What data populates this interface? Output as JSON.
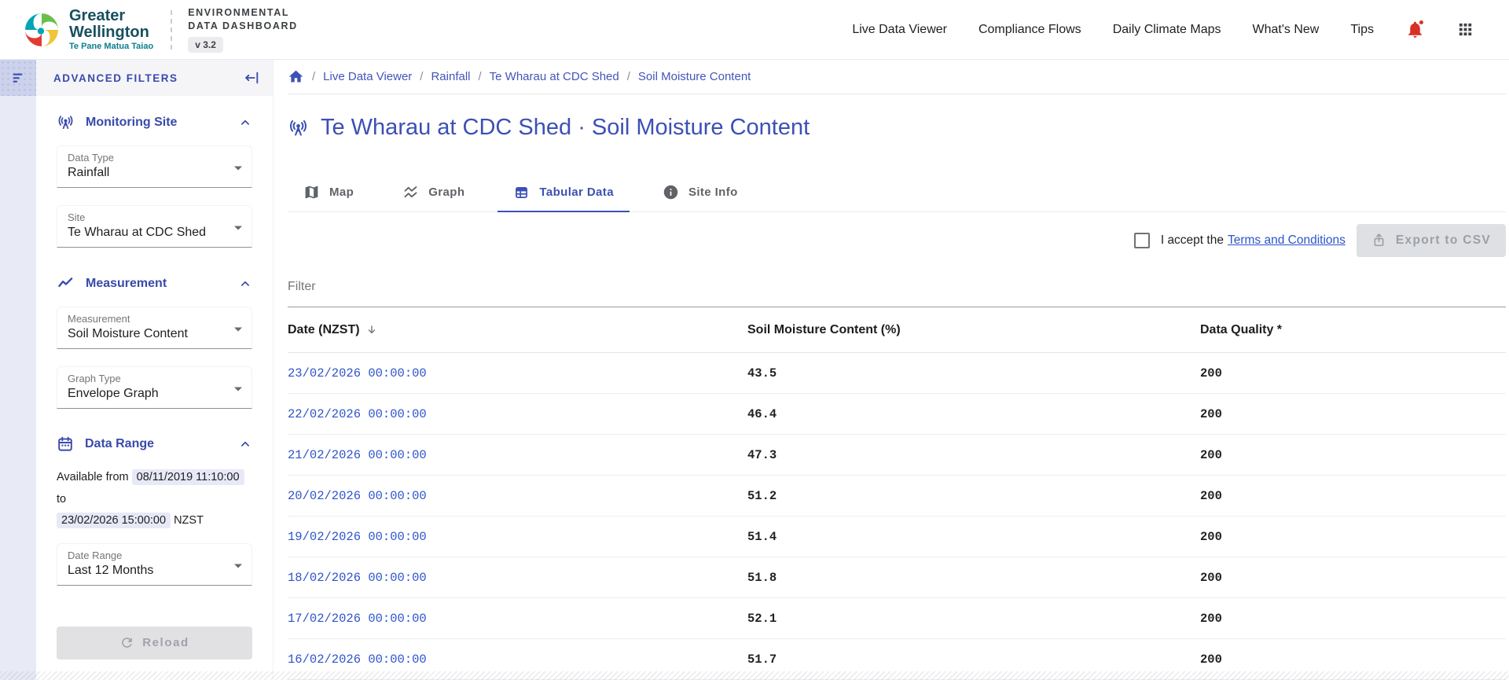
{
  "colors": {
    "primary": "#3f51b5",
    "title_blue": "#3c50b5",
    "table_link_blue": "#2d53cb",
    "bell_red": "#d93025",
    "logo_green": "#6abf4b",
    "logo_teal": "#00a5b5",
    "logo_red": "#e03c31",
    "logo_yellow": "#f2c437"
  },
  "header": {
    "logo": {
      "name_line1": "Greater",
      "name_line2": "Wellington",
      "tagline": "Te Pane Matua Taiao"
    },
    "app_title_line1": "ENVIRONMENTAL",
    "app_title_line2": "DATA DASHBOARD",
    "version": "v 3.2",
    "nav": [
      "Live Data Viewer",
      "Compliance Flows",
      "Daily Climate Maps",
      "What's New",
      "Tips"
    ]
  },
  "sidebar": {
    "header": "ADVANCED FILTERS",
    "monitoring_site": {
      "title": "Monitoring Site",
      "data_type": {
        "label": "Data Type",
        "value": "Rainfall"
      },
      "site": {
        "label": "Site",
        "value": "Te Wharau at CDC Shed"
      }
    },
    "measurement": {
      "title": "Measurement",
      "measurement": {
        "label": "Measurement",
        "value": "Soil Moisture Content"
      },
      "graph_type": {
        "label": "Graph Type",
        "value": "Envelope Graph"
      }
    },
    "data_range": {
      "title": "Data Range",
      "available_prefix": "Available from",
      "available_from": "08/11/2019 11:10:00",
      "available_joiner": "to",
      "available_to": "23/02/2026 15:00:00",
      "timezone": "NZST",
      "date_range": {
        "label": "Date Range",
        "value": "Last 12 Months"
      }
    },
    "reload_label": "Reload"
  },
  "breadcrumb": [
    "Live Data Viewer",
    "Rainfall",
    "Te Wharau at CDC Shed",
    "Soil Moisture Content"
  ],
  "page": {
    "title": "Te Wharau at CDC Shed · Soil Moisture Content"
  },
  "tabs": [
    {
      "label": "Map",
      "active": false
    },
    {
      "label": "Graph",
      "active": false
    },
    {
      "label": "Tabular Data",
      "active": true
    },
    {
      "label": "Site Info",
      "active": false
    }
  ],
  "export": {
    "accept_prefix": "I accept the",
    "terms_link": "Terms and Conditions",
    "button_label": "Export to CSV"
  },
  "filter": {
    "placeholder": "Filter"
  },
  "table": {
    "columns": [
      {
        "label": "Date (NZST)",
        "sort": "desc"
      },
      {
        "label": "Soil Moisture Content (%)",
        "sort": null
      },
      {
        "label": "Data Quality *",
        "sort": null
      }
    ],
    "rows": [
      {
        "date": "23/02/2026 00:00:00",
        "value": "43.5",
        "quality": "200"
      },
      {
        "date": "22/02/2026 00:00:00",
        "value": "46.4",
        "quality": "200"
      },
      {
        "date": "21/02/2026 00:00:00",
        "value": "47.3",
        "quality": "200"
      },
      {
        "date": "20/02/2026 00:00:00",
        "value": "51.2",
        "quality": "200"
      },
      {
        "date": "19/02/2026 00:00:00",
        "value": "51.4",
        "quality": "200"
      },
      {
        "date": "18/02/2026 00:00:00",
        "value": "51.8",
        "quality": "200"
      },
      {
        "date": "17/02/2026 00:00:00",
        "value": "52.1",
        "quality": "200"
      },
      {
        "date": "16/02/2026 00:00:00",
        "value": "51.7",
        "quality": "200"
      }
    ]
  }
}
